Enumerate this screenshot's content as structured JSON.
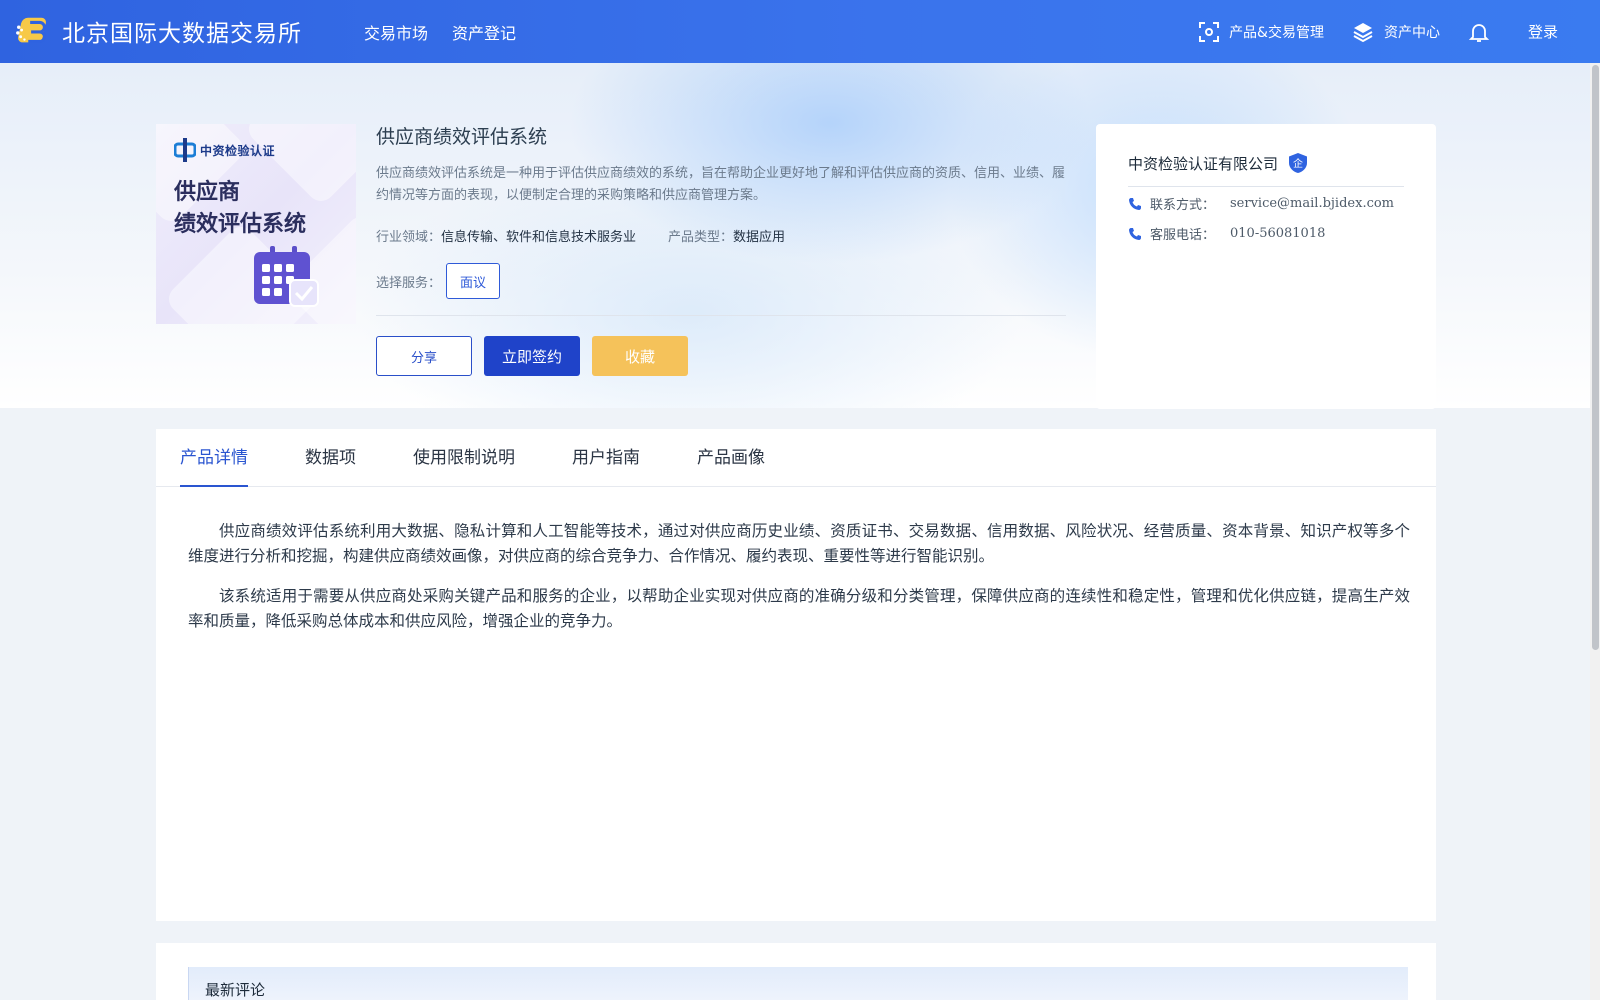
{
  "header": {
    "site_name": "北京国际大数据交易所",
    "nav": [
      "交易市场",
      "资产登记"
    ],
    "product_mgmt": "产品&交易管理",
    "asset_center": "资产中心",
    "login": "登录"
  },
  "product": {
    "image": {
      "logo_text": "中资检验认证",
      "title_line1": "供应商",
      "title_line2": "绩效评估系统"
    },
    "title": "供应商绩效评估系统",
    "description": "供应商绩效评估系统是一种用于评估供应商绩效的系统，旨在帮助企业更好地了解和评估供应商的资质、信用、业绩、履约情况等方面的表现，以便制定合理的采购策略和供应商管理方案。",
    "industry_label": "行业领域：",
    "industry_value": "信息传输、软件和信息技术服务业",
    "type_label": "产品类型：",
    "type_value": "数据应用",
    "service_label": "选择服务：",
    "service_option": "面议",
    "share_label": "分享",
    "sign_label": "立即签约",
    "favorite_label": "收藏"
  },
  "company": {
    "name": "中资检验认证有限公司",
    "badge": "企",
    "contact_label": "联系方式：",
    "contact_value": "service@mail.bjidex.com",
    "phone_label": "客服电话：",
    "phone_value": "010-56081018"
  },
  "tabs": [
    "产品详情",
    "数据项",
    "使用限制说明",
    "用户指南",
    "产品画像"
  ],
  "active_tab": "产品详情",
  "content": {
    "paragraph1": "供应商绩效评估系统利用大数据、隐私计算和人工智能等技术，通过对供应商历史业绩、资质证书、交易数据、信用数据、风险状况、经营质量、资本背景、知识产权等多个维度进行分析和挖掘，构建供应商绩效画像，对供应商的综合竞争力、合作情况、履约表现、重要性等进行智能识别。",
    "paragraph2": "该系统适用于需要从供应商处采购关键产品和服务的企业，以帮助企业实现对供应商的准确分级和分类管理，保障供应商的连续性和稳定性，管理和优化供应链，提高生产效率和质量，降低采购总体成本和供应风险，增强企业的竞争力。"
  },
  "reviews": {
    "title": "最新评论"
  },
  "colors": {
    "header": "#3a73ec",
    "primary": "#1f43c9",
    "favorite": "#f5c25a",
    "tab_active": "#2a55d0"
  }
}
